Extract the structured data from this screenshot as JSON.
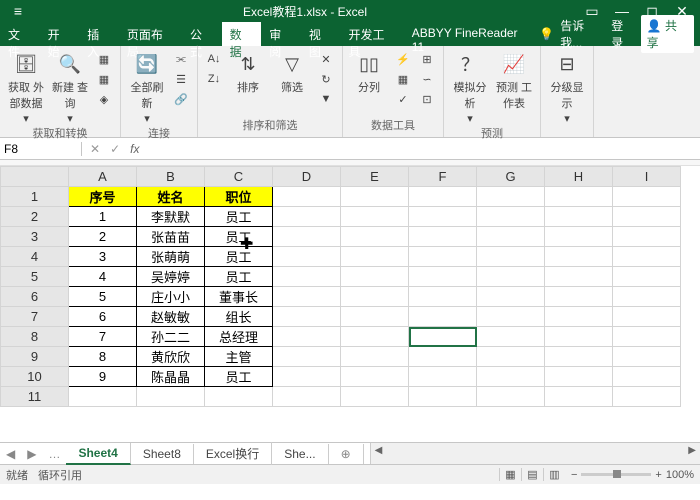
{
  "titlebar": {
    "title": "Excel教程1.xlsx - Excel"
  },
  "menubar": {
    "tabs": [
      "文件",
      "开始",
      "插入",
      "页面布局",
      "公式",
      "数据",
      "审阅",
      "视图",
      "开发工具",
      "ABBYY FineReader 11"
    ],
    "active_index": 5,
    "tell_me": "告诉我...",
    "login": "登录",
    "share": "共享"
  },
  "ribbon": {
    "groups": [
      {
        "label": "获取和转换",
        "buttons": [
          "获取\n外部数据",
          "新建\n查询",
          "全部刷新"
        ]
      },
      {
        "label": "连接",
        "buttons": []
      },
      {
        "label": "排序和筛选",
        "buttons": [
          "排序",
          "筛选"
        ]
      },
      {
        "label": "数据工具",
        "buttons": [
          "分列"
        ]
      },
      {
        "label": "预测",
        "buttons": [
          "模拟分析",
          "预测\n工作表"
        ]
      },
      {
        "label": "",
        "buttons": [
          "分级显示"
        ]
      }
    ]
  },
  "namebox": {
    "cell": "F8",
    "fx": "fx"
  },
  "columns": [
    "A",
    "B",
    "C",
    "D",
    "E",
    "F",
    "G",
    "H",
    "I"
  ],
  "rows": [
    "1",
    "2",
    "3",
    "4",
    "5",
    "6",
    "7",
    "8",
    "9",
    "10",
    "11"
  ],
  "headers": [
    "序号",
    "姓名",
    "职位"
  ],
  "data": [
    [
      "1",
      "李默默",
      "员工"
    ],
    [
      "2",
      "张苗苗",
      "员工"
    ],
    [
      "3",
      "张萌萌",
      "员工"
    ],
    [
      "4",
      "吴婷婷",
      "员工"
    ],
    [
      "5",
      "庄小小",
      "董事长"
    ],
    [
      "6",
      "赵敏敏",
      "组长"
    ],
    [
      "7",
      "孙二二",
      "总经理"
    ],
    [
      "8",
      "黄欣欣",
      "主管"
    ],
    [
      "9",
      "陈晶晶",
      "员工"
    ]
  ],
  "selected_cell": {
    "row": 8,
    "col": "F"
  },
  "sheets": {
    "tabs": [
      "Sheet4",
      "Sheet8",
      "Excel换行",
      "She..."
    ],
    "active_index": 0
  },
  "status": {
    "ready": "就绪",
    "circ": "循环引用",
    "zoom": "100%"
  }
}
